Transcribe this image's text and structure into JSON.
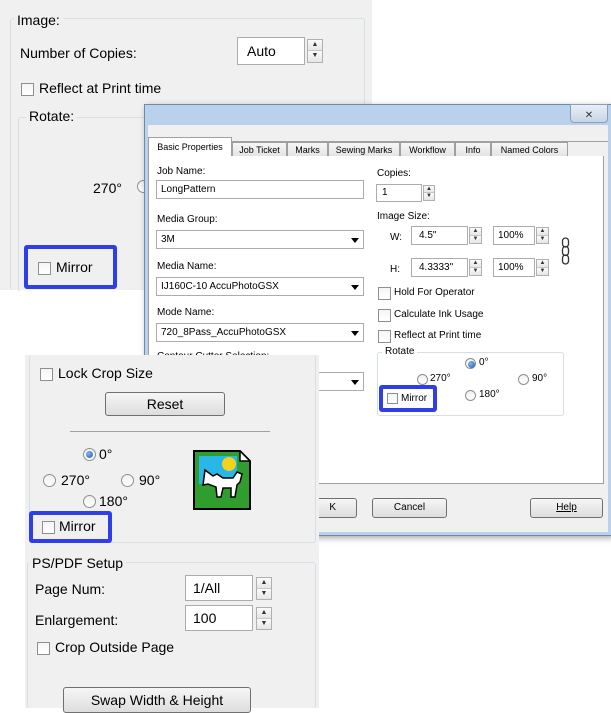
{
  "top_panel": {
    "image_label": "Image:",
    "copies_label": "Number of Copies:",
    "copies_value": "Auto",
    "reflect_label": "Reflect at Print time",
    "rotate_label": "Rotate:",
    "rotate_270": "270°",
    "mirror_label": "Mirror"
  },
  "dialog": {
    "close_glyph": "✕",
    "tabs": [
      "Basic Properties",
      "Job Ticket",
      "Marks",
      "Sewing Marks",
      "Workflow",
      "Info",
      "Named Colors"
    ],
    "job_name_label": "Job Name:",
    "job_name_value": "LongPattern",
    "media_group_label": "Media Group:",
    "media_group_value": "3M",
    "media_name_label": "Media Name:",
    "media_name_value": "IJ160C-10 AccuPhotoGSX",
    "mode_name_label": "Mode Name:",
    "mode_name_value": "720_8Pass_AccuPhotoGSX",
    "contour_label": "Contour Cutter Selection:",
    "copies_label": "Copies:",
    "copies_value": "1",
    "image_size_label": "Image Size:",
    "w_label": "W:",
    "w_value": "4.5\"",
    "w_pct": "100%",
    "h_label": "H:",
    "h_value": "4.3333\"",
    "h_pct": "100%",
    "hold_label": "Hold For Operator",
    "calc_ink_label": "Calculate Ink Usage",
    "reflect_label": "Reflect at Print time",
    "rotate_label": "Rotate",
    "rot_0": "0°",
    "rot_270": "270°",
    "rot_90": "90°",
    "rot_180": "180°",
    "mirror_label": "Mirror",
    "ok_partial": "K",
    "cancel_label": "Cancel",
    "help_label": "Help"
  },
  "crop_panel": {
    "lock_label": "Lock Crop Size",
    "reset_label": "Reset",
    "rot_0": "0°",
    "rot_270": "270°",
    "rot_90": "90°",
    "rot_180": "180°",
    "mirror_label": "Mirror",
    "ps_setup_label": "PS/PDF Setup",
    "page_num_label": "Page Num:",
    "page_num_value": "1/All",
    "enlargement_label": "Enlargement:",
    "enlargement_value": "100",
    "crop_outside_label": "Crop Outside Page",
    "swap_label": "Swap Width & Height"
  },
  "colors": {
    "highlight": "#2f3fe8",
    "title_bar": "#b9d1ea",
    "panel_bg": "#f0f0f0"
  }
}
